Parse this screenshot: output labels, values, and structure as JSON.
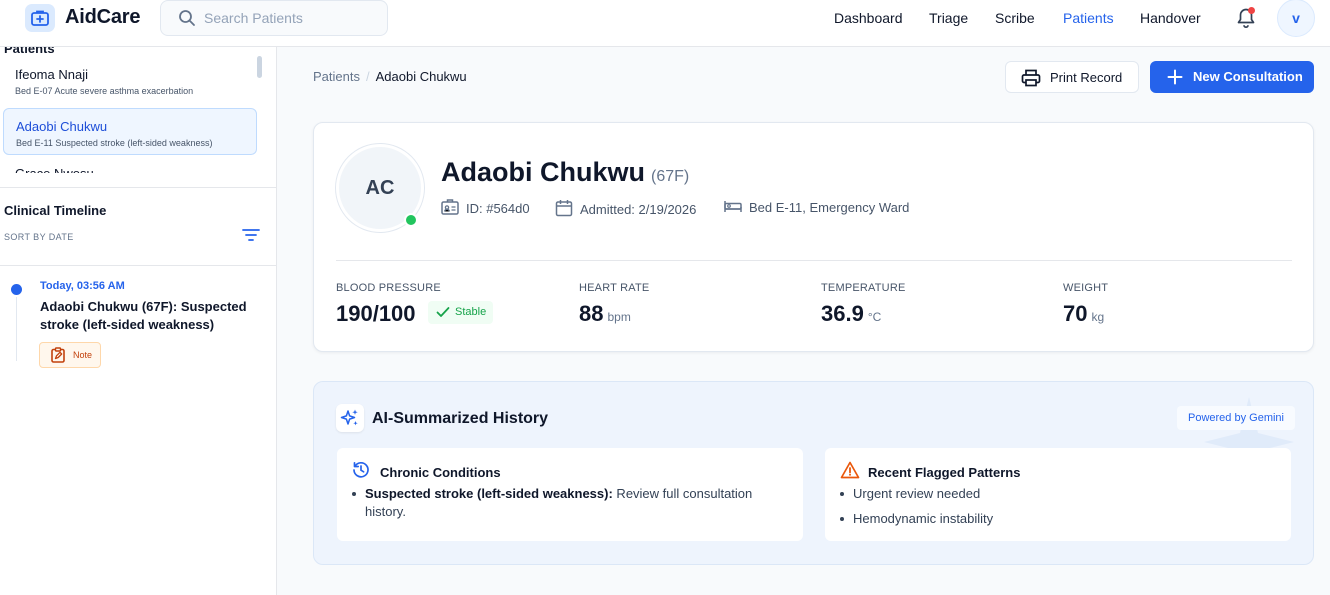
{
  "app": {
    "brand": "AidCare"
  },
  "search": {
    "placeholder": "Search Patients"
  },
  "nav": [
    {
      "label": "Dashboard",
      "active": false
    },
    {
      "label": "Triage",
      "active": false
    },
    {
      "label": "Scribe",
      "active": false
    },
    {
      "label": "Patients",
      "active": true
    },
    {
      "label": "Handover",
      "active": false
    }
  ],
  "user": {
    "initial": "v"
  },
  "sidebar": {
    "patients_heading": "Patients",
    "patients": [
      {
        "name": "Ifeoma Nnaji",
        "bed": "Bed E-07",
        "note": "Acute severe asthma exacerbation",
        "selected": false
      },
      {
        "name": "Adaobi Chukwu",
        "bed": "Bed E-11",
        "note": "Suspected stroke (left-sided weakness)",
        "selected": true
      }
    ],
    "partial_patient": "Grace Nwosu",
    "timeline": {
      "title": "Clinical Timeline",
      "sort_label": "SORT BY DATE",
      "entries": [
        {
          "time": "Today, 03:56 AM",
          "text": "Adaobi Chukwu (67F): Suspected stroke (left-sided weakness)",
          "tag": "Note"
        }
      ]
    }
  },
  "breadcrumb": {
    "root": "Patients",
    "separator": "/",
    "current": "Adaobi Chukwu"
  },
  "actions": {
    "print": "Print Record",
    "new_consultation": "New Consultation"
  },
  "patient": {
    "initials": "AC",
    "name": "Adaobi Chukwu",
    "age_sex": "(67F)",
    "id": "ID: #564d0",
    "admitted": "Admitted: 2/19/2026",
    "bed": "Bed E-11, Emergency Ward",
    "vitals": {
      "bp": {
        "label": "BLOOD PRESSURE",
        "value": "190/100",
        "badge": "Stable"
      },
      "hr": {
        "label": "HEART RATE",
        "value": "88",
        "unit": "bpm"
      },
      "temp": {
        "label": "TEMPERATURE",
        "value": "36.9",
        "unit": "°C"
      },
      "weight": {
        "label": "WEIGHT",
        "value": "70",
        "unit": "kg"
      }
    }
  },
  "ai_summary": {
    "title": "AI-Summarized History",
    "powered_by": "Powered by Gemini",
    "chronic": {
      "title": "Chronic Conditions",
      "items": [
        {
          "bold": "Suspected stroke (left-sided weakness):",
          "text": " Review full consultation history."
        }
      ]
    },
    "flagged": {
      "title": "Recent Flagged Patterns",
      "items": [
        "Urgent review needed",
        "Hemodynamic instability"
      ]
    }
  },
  "colors": {
    "primary": "#2563eb",
    "success": "#22c55e",
    "warning": "#ea580c",
    "alert": "#ef4444"
  }
}
